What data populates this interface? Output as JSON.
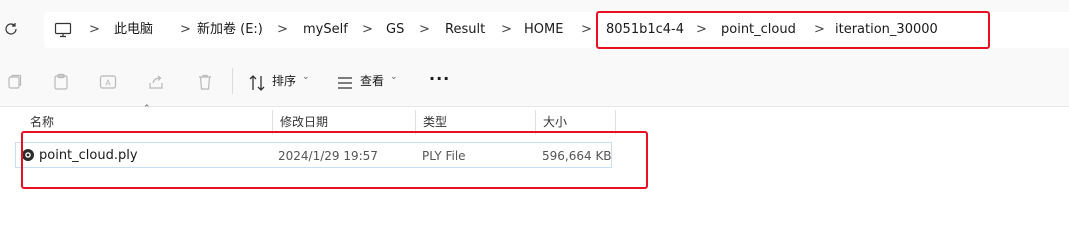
{
  "address": {
    "segments": [
      "此电脑",
      "新加卷 (E:)",
      "mySelf",
      "GS",
      "Result",
      "HOME",
      "8051b1c4-4",
      "point_cloud",
      "iteration_30000"
    ],
    "separator": ">"
  },
  "toolbar": {
    "sort_label": "排序",
    "view_label": "查看",
    "more_label": "···"
  },
  "columns": {
    "name": "名称",
    "modified": "修改日期",
    "type": "类型",
    "size": "大小"
  },
  "files": [
    {
      "name": "point_cloud.ply",
      "modified": "2024/1/29 19:57",
      "type": "PLY File",
      "size": "596,664 KB"
    }
  ],
  "colors": {
    "highlight": "#e81123",
    "selection_border": "#c9def5"
  }
}
